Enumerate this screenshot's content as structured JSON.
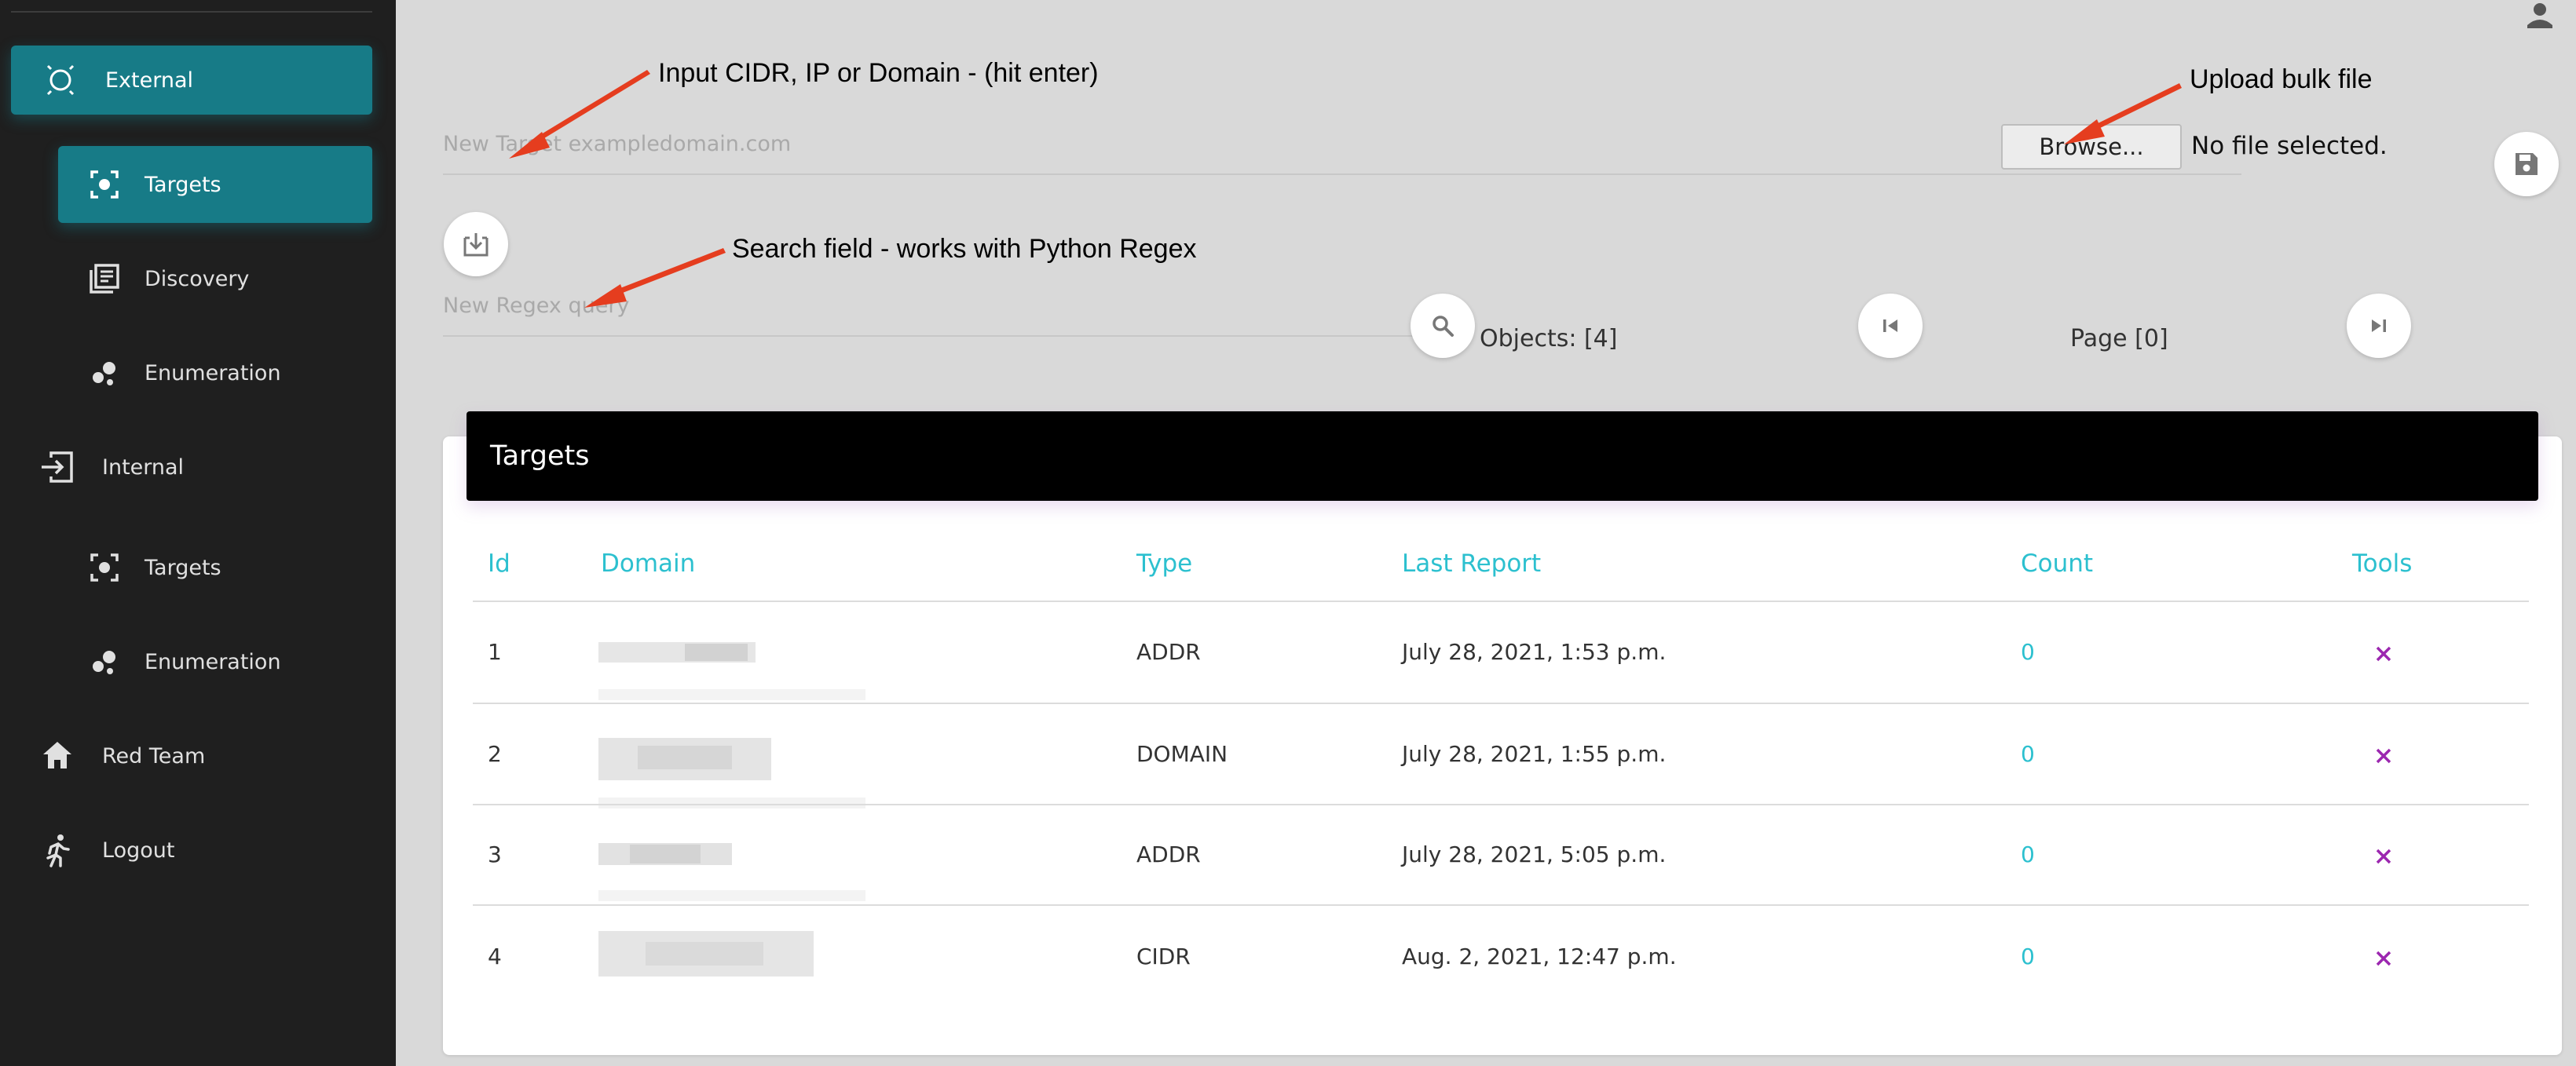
{
  "sidebar": {
    "items": [
      {
        "label": "External",
        "icon": "radar-icon"
      },
      {
        "label": "Targets",
        "icon": "target-scan-icon"
      },
      {
        "label": "Discovery",
        "icon": "library-icon"
      },
      {
        "label": "Enumeration",
        "icon": "bubble-chart-icon"
      },
      {
        "label": "Internal",
        "icon": "login-icon"
      },
      {
        "label": "Targets",
        "icon": "target-scan-icon"
      },
      {
        "label": "Enumeration",
        "icon": "bubble-chart-icon"
      },
      {
        "label": "Red Team",
        "icon": "home-icon"
      },
      {
        "label": "Logout",
        "icon": "running-person-icon"
      }
    ]
  },
  "inputs": {
    "new_target_placeholder": "New Target exampledomain.com",
    "regex_placeholder": "New Regex query"
  },
  "upload": {
    "browse_label": "Browse...",
    "file_status": "No file selected."
  },
  "stats": {
    "objects": "Objects: [4]",
    "page": "Page [0]"
  },
  "annotations": {
    "input_hint": "Input CIDR, IP or Domain - (hit enter)",
    "upload_hint": "Upload bulk file",
    "search_hint": "Search field - works with Python Regex"
  },
  "table": {
    "title": "Targets",
    "columns": [
      "Id",
      "Domain",
      "Type",
      "Last Report",
      "Count",
      "Tools"
    ],
    "rows": [
      {
        "id": "1",
        "type": "ADDR",
        "last_report": "July 28, 2021, 1:53 p.m.",
        "count": "0"
      },
      {
        "id": "2",
        "type": "DOMAIN",
        "last_report": "July 28, 2021, 1:55 p.m.",
        "count": "0"
      },
      {
        "id": "3",
        "type": "ADDR",
        "last_report": "July 28, 2021, 5:05 p.m.",
        "count": "0"
      },
      {
        "id": "4",
        "type": "CIDR",
        "last_report": "Aug. 2, 2021, 12:47 p.m.",
        "count": "0"
      }
    ]
  },
  "colors": {
    "accent": "#177b87",
    "link": "#2cc0cf",
    "delete": "#9c27b0",
    "arrow": "#e53d1f"
  }
}
